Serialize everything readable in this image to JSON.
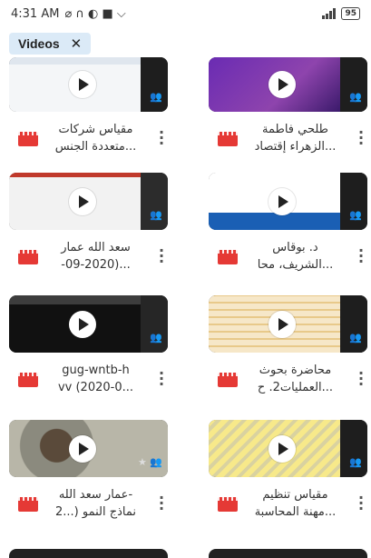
{
  "status": {
    "time": "4:31 AM",
    "battery": "95"
  },
  "filter_chip": {
    "label": "Videos",
    "close": "✕"
  },
  "videos": [
    {
      "title_line1": "مقياس شركات",
      "title_line2": "متعددة الجنس..."
    },
    {
      "title_line1": "طلحي فاطمة",
      "title_line2": "الزهراء إقتصاد..."
    },
    {
      "title_line1": "سعد الله عمار",
      "title_line2": "-09-2020)..."
    },
    {
      "title_line1": "د. بوقاس",
      "title_line2": "الشريف، محا..."
    },
    {
      "title_line1": "gug-wntb-h",
      "title_line2": "vv (2020-0..."
    },
    {
      "title_line1": "محاضرة بحوث",
      "title_line2": "العمليات2. ح..."
    },
    {
      "title_line1": "عمار سعد الله-",
      "title_line2": "نماذج النمو (...2"
    },
    {
      "title_line1": "مقياس تنظيم",
      "title_line2": "مهنة المحاسبة..."
    }
  ],
  "colors": {
    "chip_bg": "#dbeaf7",
    "video_icon": "#e53935"
  }
}
